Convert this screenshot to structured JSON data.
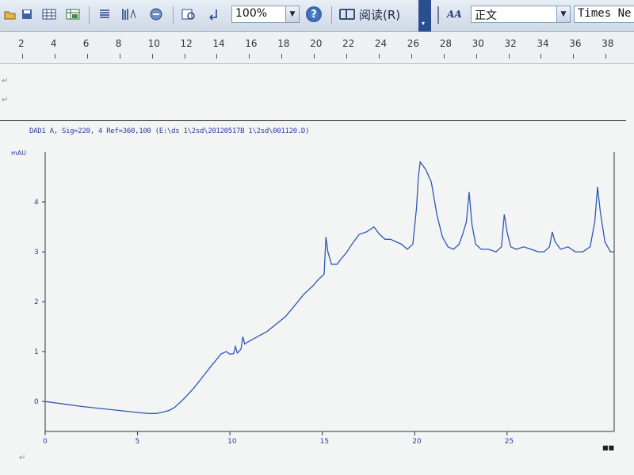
{
  "toolbar": {
    "zoom": "100%",
    "read_label": "阅读(R)",
    "style_icon_text": "A",
    "style_icon_sub": "A",
    "paragraph_style": "正文",
    "font_name": "Times Ne",
    "help_glyph": "?"
  },
  "ruler": {
    "labels": [
      "2",
      "4",
      "6",
      "8",
      "10",
      "12",
      "14",
      "16",
      "18",
      "20",
      "22",
      "24",
      "26",
      "28",
      "30",
      "32",
      "34",
      "36",
      "38"
    ]
  },
  "chart_data": {
    "type": "line",
    "header": "DAD1 A, Sig=220, 4 Ref=360,100 (E:\\ds 1\\2sd\\20120517B 1\\2sd\\001120.D)",
    "ylabel": "mAU",
    "x_ticks": [
      "0",
      "5",
      "10",
      "15",
      "20",
      "25"
    ],
    "y_ticks": [
      "0",
      "1",
      "2",
      "3",
      "4"
    ],
    "xlim": [
      0,
      30.8
    ],
    "ylim": [
      -0.6,
      5.0
    ],
    "colors": {
      "series": "#2f57b8"
    },
    "series": [
      {
        "points": [
          [
            0,
            0.0
          ],
          [
            1,
            -0.05
          ],
          [
            2,
            -0.1
          ],
          [
            3,
            -0.14
          ],
          [
            4,
            -0.18
          ],
          [
            5,
            -0.22
          ],
          [
            5.6,
            -0.24
          ],
          [
            6,
            -0.24
          ],
          [
            6.3,
            -0.22
          ],
          [
            6.7,
            -0.18
          ],
          [
            7,
            -0.12
          ],
          [
            7.5,
            0.05
          ],
          [
            8,
            0.25
          ],
          [
            8.5,
            0.48
          ],
          [
            9,
            0.72
          ],
          [
            9.3,
            0.85
          ],
          [
            9.5,
            0.95
          ],
          [
            9.8,
            1.0
          ],
          [
            10,
            0.95
          ],
          [
            10.2,
            0.96
          ],
          [
            10.3,
            1.1
          ],
          [
            10.4,
            0.97
          ],
          [
            10.6,
            1.05
          ],
          [
            10.7,
            1.3
          ],
          [
            10.8,
            1.15
          ],
          [
            11,
            1.2
          ],
          [
            11.5,
            1.3
          ],
          [
            12,
            1.4
          ],
          [
            12.5,
            1.55
          ],
          [
            13,
            1.7
          ],
          [
            13.5,
            1.92
          ],
          [
            14,
            2.15
          ],
          [
            14.5,
            2.32
          ],
          [
            14.8,
            2.45
          ],
          [
            15.1,
            2.55
          ],
          [
            15.2,
            3.3
          ],
          [
            15.3,
            3.0
          ],
          [
            15.5,
            2.75
          ],
          [
            15.8,
            2.75
          ],
          [
            16,
            2.85
          ],
          [
            16.3,
            2.98
          ],
          [
            16.6,
            3.15
          ],
          [
            17,
            3.35
          ],
          [
            17.4,
            3.4
          ],
          [
            17.8,
            3.5
          ],
          [
            18.1,
            3.35
          ],
          [
            18.4,
            3.25
          ],
          [
            18.7,
            3.25
          ],
          [
            19,
            3.2
          ],
          [
            19.3,
            3.15
          ],
          [
            19.6,
            3.05
          ],
          [
            19.9,
            3.15
          ],
          [
            20.1,
            3.88
          ],
          [
            20.2,
            4.5
          ],
          [
            20.3,
            4.8
          ],
          [
            20.6,
            4.65
          ],
          [
            20.9,
            4.4
          ],
          [
            21.2,
            3.75
          ],
          [
            21.5,
            3.3
          ],
          [
            21.8,
            3.1
          ],
          [
            22.1,
            3.05
          ],
          [
            22.4,
            3.15
          ],
          [
            22.6,
            3.35
          ],
          [
            22.8,
            3.6
          ],
          [
            22.95,
            4.2
          ],
          [
            23.1,
            3.55
          ],
          [
            23.3,
            3.15
          ],
          [
            23.6,
            3.05
          ],
          [
            24,
            3.05
          ],
          [
            24.4,
            3.0
          ],
          [
            24.7,
            3.1
          ],
          [
            24.85,
            3.75
          ],
          [
            25,
            3.4
          ],
          [
            25.2,
            3.1
          ],
          [
            25.5,
            3.05
          ],
          [
            25.9,
            3.1
          ],
          [
            26.3,
            3.05
          ],
          [
            26.7,
            3.0
          ],
          [
            27,
            3.0
          ],
          [
            27.3,
            3.1
          ],
          [
            27.45,
            3.4
          ],
          [
            27.6,
            3.2
          ],
          [
            27.9,
            3.05
          ],
          [
            28.3,
            3.1
          ],
          [
            28.7,
            3.0
          ],
          [
            29.1,
            3.0
          ],
          [
            29.5,
            3.1
          ],
          [
            29.75,
            3.6
          ],
          [
            29.9,
            4.3
          ],
          [
            30.05,
            3.8
          ],
          [
            30.3,
            3.2
          ],
          [
            30.6,
            3.0
          ],
          [
            30.8,
            3.0
          ]
        ]
      }
    ]
  }
}
